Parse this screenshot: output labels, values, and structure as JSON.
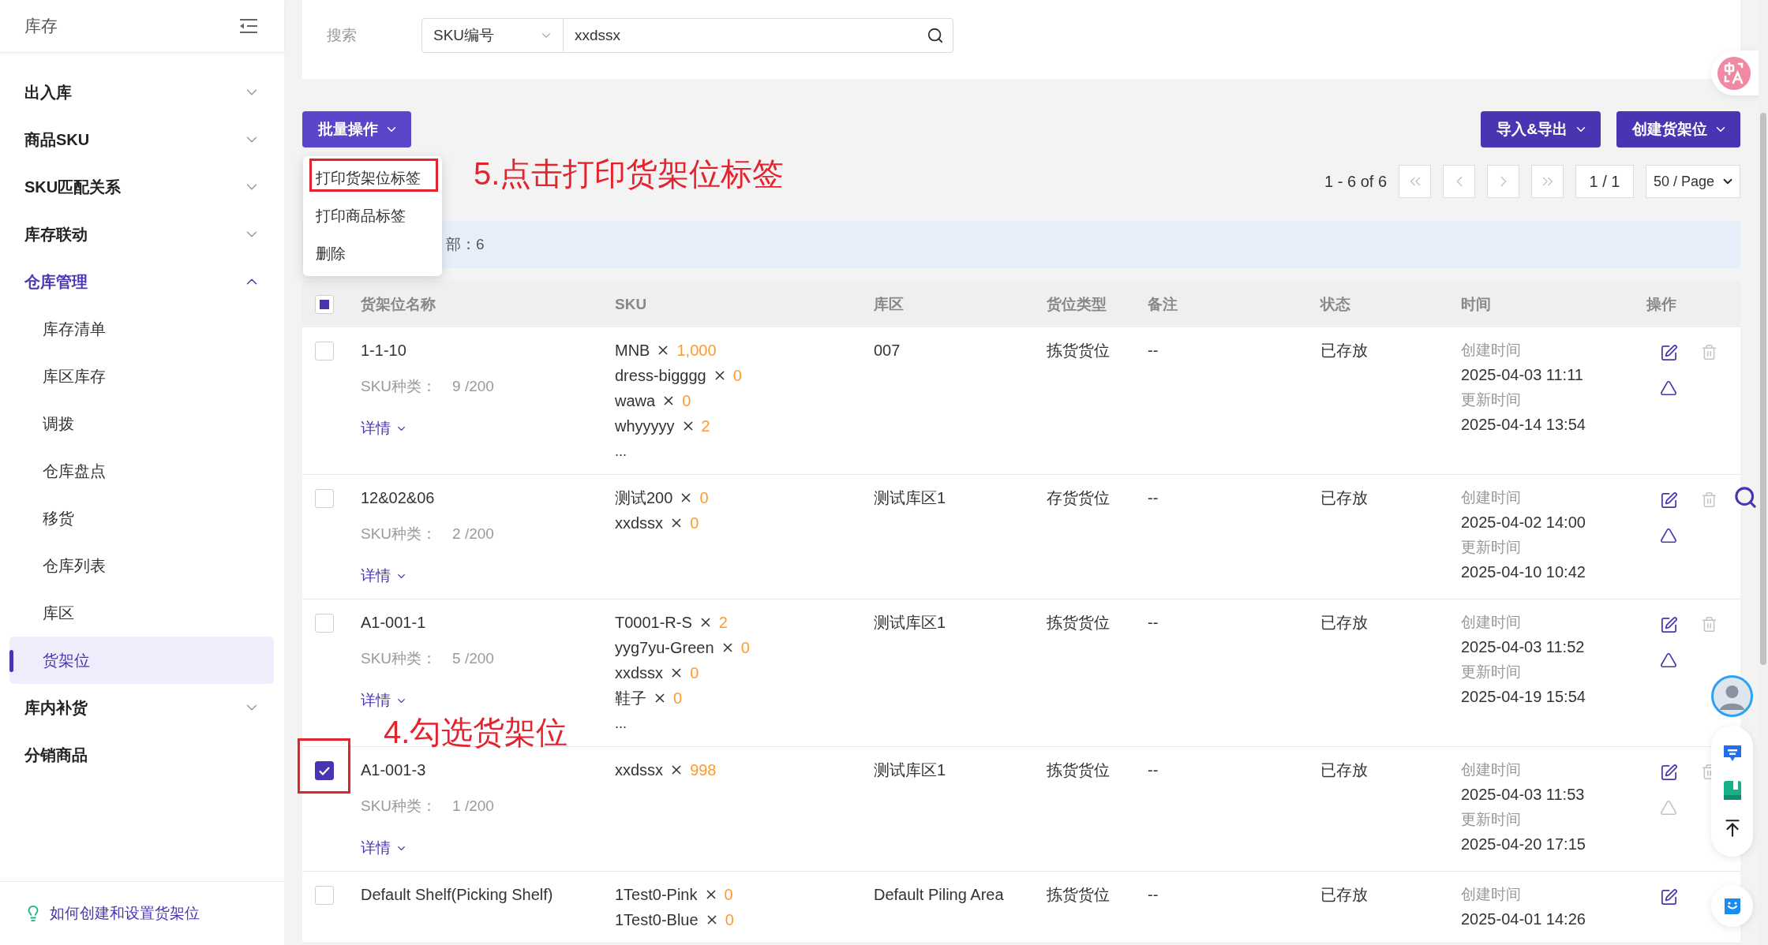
{
  "sidebar": {
    "title": "库存",
    "items": [
      {
        "kind": "group",
        "label": "出入库",
        "expanded": false
      },
      {
        "kind": "group",
        "label": "商品SKU",
        "expanded": false
      },
      {
        "kind": "group",
        "label": "SKU匹配关系",
        "expanded": false
      },
      {
        "kind": "group",
        "label": "库存联动",
        "expanded": false
      },
      {
        "kind": "group",
        "label": "仓库管理",
        "expanded": true,
        "children": [
          {
            "label": "库存清单",
            "selected": false
          },
          {
            "label": "库区库存",
            "selected": false
          },
          {
            "label": "调拨",
            "selected": false
          },
          {
            "label": "仓库盘点",
            "selected": false
          },
          {
            "label": "移货",
            "selected": false
          },
          {
            "label": "仓库列表",
            "selected": false
          },
          {
            "label": "库区",
            "selected": false
          },
          {
            "label": "货架位",
            "selected": true
          }
        ]
      },
      {
        "kind": "group",
        "label": "库内补货",
        "expanded": false
      },
      {
        "kind": "link",
        "label": "分销商品"
      }
    ],
    "help_link": "如何创建和设置货架位"
  },
  "search": {
    "label": "搜索",
    "field": "SKU编号",
    "value": "xxdssx"
  },
  "toolbar": {
    "batch": {
      "label": "批量操作",
      "open": true,
      "items": [
        {
          "label": "打印货架位标签",
          "marked": true,
          "note": "5.点击打印货架位标签"
        },
        {
          "label": "打印商品标签",
          "marked": false
        },
        {
          "label": "删除",
          "marked": false
        }
      ]
    },
    "buttons": [
      "导入&导出",
      "创建货架位"
    ]
  },
  "pagination": {
    "range": "1 - 6 of 6",
    "nav": [
      {
        "kind": "first",
        "disabled": true
      },
      {
        "kind": "prev",
        "disabled": true
      },
      {
        "kind": "next",
        "disabled": true
      },
      {
        "kind": "last",
        "disabled": true
      }
    ],
    "page": "1 / 1",
    "page_size": "50 / Page"
  },
  "selection_bar": {
    "text": "部：6"
  },
  "table": {
    "select_all": {
      "checked": false,
      "indeterminate": true
    },
    "columns": [
      "货架位名称",
      "SKU",
      "库区",
      "货位类型",
      "备注",
      "状态",
      "时间",
      "操作"
    ],
    "rows": [
      {
        "selected": false,
        "marked": false,
        "name": "1-1-10",
        "kinds_label": "SKU种类：",
        "kinds": "9 /200",
        "details": "详情",
        "skus": [
          {
            "name": "MNB",
            "qty": "1,000"
          },
          {
            "name": "dress-bigggg",
            "qty": "0"
          },
          {
            "name": "wawa",
            "qty": "0"
          },
          {
            "name": "whyyyyy",
            "qty": "2"
          }
        ],
        "more": "...",
        "zone": "007",
        "type": "拣货货位",
        "note": "--",
        "status": "已存放",
        "created_label": "创建时间",
        "created": "2025-04-03 11:11",
        "updated_label": "更新时间",
        "updated": "2025-04-14 13:54",
        "actions": [
          {
            "kind": "edit",
            "disabled": false
          },
          {
            "kind": "delete",
            "disabled": true
          },
          {
            "kind": "alert",
            "disabled": false
          }
        ]
      },
      {
        "selected": false,
        "marked": false,
        "name": "12&02&06",
        "kinds_label": "SKU种类：",
        "kinds": "2 /200",
        "details": "详情",
        "skus": [
          {
            "name": "测试200",
            "qty": "0"
          },
          {
            "name": "xxdssx",
            "qty": "0"
          }
        ],
        "zone": "测试库区1",
        "type": "存货货位",
        "note": "--",
        "status": "已存放",
        "created_label": "创建时间",
        "created": "2025-04-02 14:00",
        "updated_label": "更新时间",
        "updated": "2025-04-10 10:42",
        "actions": [
          {
            "kind": "edit",
            "disabled": false
          },
          {
            "kind": "delete",
            "disabled": true
          },
          {
            "kind": "alert",
            "disabled": false
          }
        ]
      },
      {
        "selected": false,
        "marked": false,
        "name": "A1-001-1",
        "kinds_label": "SKU种类：",
        "kinds": "5 /200",
        "details": "详情",
        "skus": [
          {
            "name": "T0001-R-S",
            "qty": "2"
          },
          {
            "name": "yyg7yu-Green",
            "qty": "0"
          },
          {
            "name": "xxdssx",
            "qty": "0"
          },
          {
            "name": "鞋子",
            "qty": "0"
          }
        ],
        "more": "...",
        "zone": "测试库区1",
        "type": "拣货货位",
        "note": "--",
        "status": "已存放",
        "created_label": "创建时间",
        "created": "2025-04-03 11:52",
        "updated_label": "更新时间",
        "updated": "2025-04-19 15:54",
        "actions": [
          {
            "kind": "edit",
            "disabled": false
          },
          {
            "kind": "delete",
            "disabled": true
          },
          {
            "kind": "alert",
            "disabled": false
          }
        ]
      },
      {
        "selected": true,
        "marked": true,
        "row_note": "4.勾选货架位",
        "name": "A1-001-3",
        "kinds_label": "SKU种类：",
        "kinds": "1 /200",
        "details": "详情",
        "skus": [
          {
            "name": "xxdssx",
            "qty": "998"
          }
        ],
        "zone": "测试库区1",
        "type": "拣货货位",
        "note": "--",
        "status": "已存放",
        "created_label": "创建时间",
        "created": "2025-04-03 11:53",
        "updated_label": "更新时间",
        "updated": "2025-04-20 17:15",
        "actions": [
          {
            "kind": "edit",
            "disabled": false
          },
          {
            "kind": "delete",
            "disabled": true
          },
          {
            "kind": "alert",
            "disabled": true
          }
        ]
      },
      {
        "selected": false,
        "marked": false,
        "name": "Default Shelf(Picking Shelf)",
        "skus": [
          {
            "name": "1Test0-Pink",
            "qty": "0"
          },
          {
            "name": "1Test0-Blue",
            "qty": "0"
          }
        ],
        "zone": "Default Piling Area",
        "type": "拣货货位",
        "note": "--",
        "status": "已存放",
        "created_label": "创建时间",
        "created": "2025-04-01 14:26",
        "actions": [
          {
            "kind": "edit",
            "disabled": false
          }
        ]
      }
    ]
  }
}
